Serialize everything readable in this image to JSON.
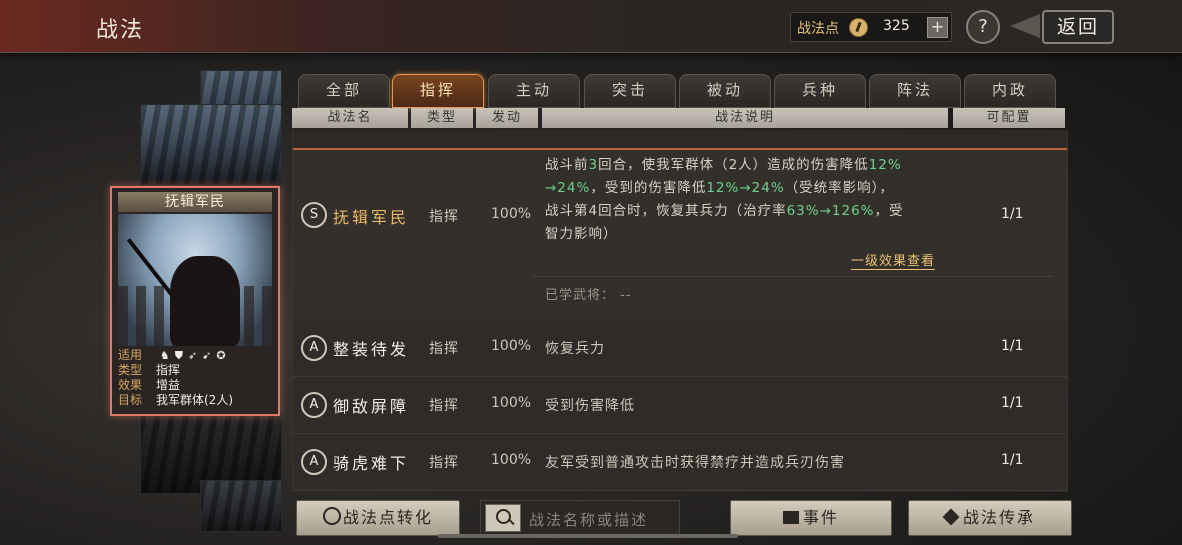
{
  "header": {
    "title": "战法",
    "points_label": "战法点",
    "points_value": "325",
    "plus": "+",
    "help": "?",
    "back_label": "返回"
  },
  "card": {
    "name": "抚辑军民",
    "info": [
      {
        "key": "适用",
        "value": ""
      },
      {
        "key": "类型",
        "value": "指挥"
      },
      {
        "key": "效果",
        "value": "增益"
      },
      {
        "key": "目标",
        "value": "我军群体(2人)"
      }
    ],
    "troop_icons": [
      "cavalry-icon",
      "shield-icon",
      "bow-icon",
      "spear-icon",
      "wheel-icon"
    ]
  },
  "tabs": [
    "全部",
    "指挥",
    "主动",
    "突击",
    "被动",
    "兵种",
    "阵法",
    "内政"
  ],
  "active_tab": 1,
  "columns": [
    "战法名",
    "类型",
    "发动",
    "战法说明",
    "可配置"
  ],
  "rows": [
    {
      "grade": "S",
      "name": "抚辑军民",
      "type": "指挥",
      "rate": "100%",
      "config": "1/1",
      "desc_lines": [
        [
          {
            "t": "战斗前"
          },
          {
            "t": "3",
            "g": true
          },
          {
            "t": "回合，使我军群体（2人）造成的伤害降低"
          },
          {
            "t": "12%",
            "g": true
          }
        ],
        [
          {
            "t": "→24%",
            "g": true
          },
          {
            "t": "，受到的伤害降低"
          },
          {
            "t": "12%→24%",
            "g": true
          },
          {
            "t": "（受统率影响），"
          }
        ],
        [
          {
            "t": "战斗第4回合时，恢复其兵力（治疗率"
          },
          {
            "t": "63%→126%",
            "g": true
          },
          {
            "t": "，受"
          }
        ],
        [
          {
            "t": "智力影响）"
          }
        ]
      ],
      "detail_link": "一级效果查看",
      "learned_label": "已学武将：",
      "learned_value": "--"
    },
    {
      "grade": "A",
      "name": "整装待发",
      "type": "指挥",
      "rate": "100%",
      "desc": "恢复兵力",
      "config": "1/1"
    },
    {
      "grade": "A",
      "name": "御敌屏障",
      "type": "指挥",
      "rate": "100%",
      "desc": "受到伤害降低",
      "config": "1/1"
    },
    {
      "grade": "A",
      "name": "骑虎难下",
      "type": "指挥",
      "rate": "100%",
      "desc": "友军受到普通攻击时获得禁疗并造成兵刃伤害",
      "config": "1/1"
    }
  ],
  "bottom": {
    "convert_label": "战法点转化",
    "search_placeholder": "战法名称或描述",
    "event_label": "事件",
    "inherit_label": "战法传承"
  }
}
